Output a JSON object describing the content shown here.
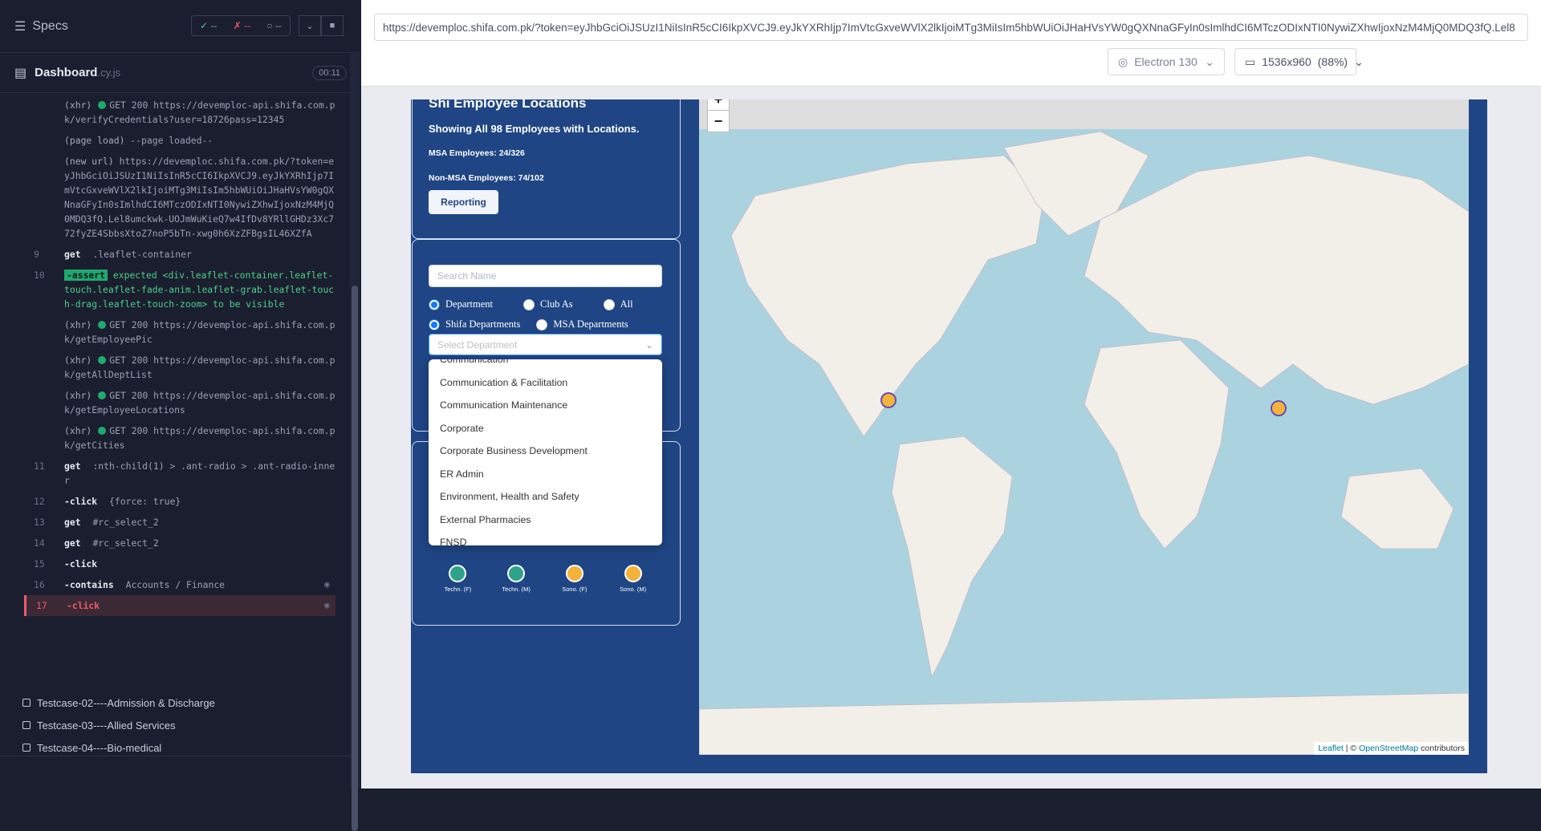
{
  "runner": {
    "specs_label": "Specs",
    "stats": {
      "passed": "--",
      "failed": "--",
      "pending": "--"
    },
    "spec_name": "Dashboard",
    "spec_ext": ".cy.js",
    "timer": "00:11",
    "log": [
      {
        "num": "",
        "type": "xhr",
        "text": "(xhr)",
        "dot": true,
        "detail": "GET 200 https://devemploc-api.shifa.com.pk/verifyCredentials?user=18726pass=12345"
      },
      {
        "num": "",
        "type": "plain",
        "text": "(page load)",
        "detail": "--page loaded--"
      },
      {
        "num": "",
        "type": "plain",
        "text": "(new url)",
        "detail": "https://devemploc.shifa.com.pk/?token=eyJhbGciOiJSUzI1NiIsInR5cCI6IkpXVCJ9.eyJkYXRhIjp7ImVtcGxveWVlX2lkIjoiMTg3MiIsIm5hbWUiOiJHaHVsYW0gQXNnaGFyIn0sImlhdCI6MTczODIxNTI0NywiZXhwIjoxNzM4MjQ0MDQ3fQ.Lel8umckwk-UOJmWuKieQ7w4IfDv8YRllGHDz3Xc772fyZE4SbbsXtoZ7noP5bTn-xwg0h6XzZFBgsIL46XZfA"
      },
      {
        "num": "9",
        "type": "cmd",
        "text": "get",
        "detail": ".leaflet-container"
      },
      {
        "num": "10",
        "type": "assert",
        "text": "-assert",
        "detail": "expected <div.leaflet-container.leaflet-touch.leaflet-fade-anim.leaflet-grab.leaflet-touch-drag.leaflet-touch-zoom> to be visible"
      },
      {
        "num": "",
        "type": "xhr",
        "text": "(xhr)",
        "dot": true,
        "detail": "GET 200 https://devemploc-api.shifa.com.pk/getEmployeePic"
      },
      {
        "num": "",
        "type": "xhr",
        "text": "(xhr)",
        "dot": true,
        "detail": "GET 200 https://devemploc-api.shifa.com.pk/getAllDeptList"
      },
      {
        "num": "",
        "type": "xhr",
        "text": "(xhr)",
        "dot": true,
        "detail": "GET 200 https://devemploc-api.shifa.com.pk/getEmployeeLocations"
      },
      {
        "num": "",
        "type": "xhr",
        "text": "(xhr)",
        "dot": true,
        "detail": "GET 200 https://devemploc-api.shifa.com.pk/getCities"
      },
      {
        "num": "11",
        "type": "cmd",
        "text": "get",
        "detail": ":nth-child(1) > .ant-radio > .ant-radio-inner"
      },
      {
        "num": "12",
        "type": "cmd",
        "text": "-click",
        "detail": "{force: true}"
      },
      {
        "num": "13",
        "type": "cmd",
        "text": "get",
        "detail": "#rc_select_2"
      },
      {
        "num": "14",
        "type": "cmd",
        "text": "get",
        "detail": "#rc_select_2"
      },
      {
        "num": "15",
        "type": "cmd",
        "text": "-click",
        "detail": ""
      },
      {
        "num": "16",
        "type": "cmd",
        "text": "-contains",
        "detail": "Accounts / Finance",
        "eye": true
      },
      {
        "num": "17",
        "type": "active",
        "text": "-click",
        "detail": "",
        "eye": true
      }
    ],
    "tests": [
      "Testcase-02----Admission & Discharge",
      "Testcase-03----Allied Services",
      "Testcase-04----Bio-medical"
    ]
  },
  "browser": {
    "url": "https://devemploc.shifa.com.pk/?token=eyJhbGciOiJSUzI1NiIsInR5cCI6IkpXVCJ9.eyJkYXRhIjp7ImVtcGxveWVlX2lkIjoiMTg3MiIsIm5hbWUiOiJHaHVsYW0gQXNnaGFyIn0sImlhdCI6MTczODIxNTI0NywiZXhwIjoxNzM4MjQ0MDQ3fQ.Lel8",
    "browser_label": "Electron 130",
    "viewport_label": "1536x960",
    "viewport_scale": "(88%)"
  },
  "app": {
    "title": "Shi Employee Locations",
    "showing": "Showing All 98 Employees with Locations.",
    "msa": "MSA Employees: 24/326",
    "non_msa": "Non-MSA Employees: 74/102",
    "reporting_button": "Reporting",
    "search_placeholder": "Search Name",
    "radio_dept": "Department",
    "radio_club": "Club As",
    "radio_all": "All",
    "radio_shifa": "Shifa Departments",
    "radio_msa": "MSA Departments",
    "select_placeholder": "Select Department",
    "dropdown_options": [
      "Communication",
      "Communication & Facilitation",
      "Communication Maintenance",
      "Corporate",
      "Corporate Business Development",
      "ER Admin",
      "Environment, Health and Safety",
      "External Pharmacies",
      "FNSD"
    ],
    "avatars": [
      "Techn. (F)",
      "Techn. (M)",
      "Sono. (F)",
      "Sono. (M)"
    ],
    "zoom_in": "+",
    "zoom_out": "−",
    "attribution_leaflet": "Leaflet",
    "attribution_sep": " | © ",
    "attribution_osm": "OpenStreetMap",
    "attribution_tail": " contributors"
  },
  "colors": {
    "app_blue": "#1f4584",
    "runner_bg": "#1b1e2e",
    "ocean": "#aad3df",
    "land": "#f2efe9"
  }
}
